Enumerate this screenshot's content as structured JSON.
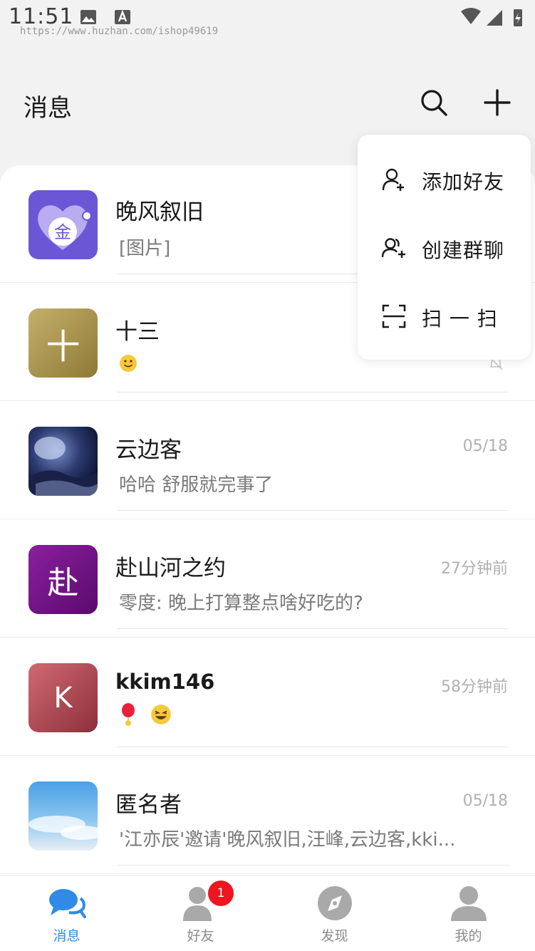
{
  "status": {
    "time": "11:51",
    "url": "https://www.huzhan.com/ishop49619"
  },
  "header": {
    "title": "消息"
  },
  "conversations": [
    {
      "name": "晚风叙旧",
      "preview": "[图片]",
      "time": "",
      "avatar_text": "金"
    },
    {
      "name": "十三",
      "preview": "",
      "time": "",
      "avatar_text": "十"
    },
    {
      "name": "云边客",
      "preview": "哈哈 舒服就完事了",
      "time": "05/18",
      "avatar_text": ""
    },
    {
      "name": "赴山河之约",
      "preview": "零度: 晚上打算整点啥好吃的?",
      "time": "27分钟前",
      "avatar_text": "赴"
    },
    {
      "name": "kkim146",
      "preview": "",
      "time": "58分钟前",
      "avatar_text": "K"
    },
    {
      "name": "匿名者",
      "preview": "'江亦辰'邀请'晚风叙旧,汪峰,云边客,kki...",
      "time": "05/18",
      "avatar_text": ""
    }
  ],
  "popup_menu": {
    "items": [
      {
        "label": "添加好友",
        "icon": "add-friend-icon"
      },
      {
        "label": "创建群聊",
        "icon": "create-group-icon"
      },
      {
        "label": "扫 一 扫",
        "icon": "scan-icon"
      }
    ]
  },
  "tabbar": {
    "tabs": [
      {
        "label": "消息",
        "icon": "chat-bubbles-icon",
        "active": true
      },
      {
        "label": "好友",
        "icon": "friends-icon",
        "badge": "1"
      },
      {
        "label": "发现",
        "icon": "compass-icon"
      },
      {
        "label": "我的",
        "icon": "profile-icon"
      }
    ]
  },
  "colors": {
    "accent": "#2f8be6",
    "badge": "#f0141e"
  }
}
